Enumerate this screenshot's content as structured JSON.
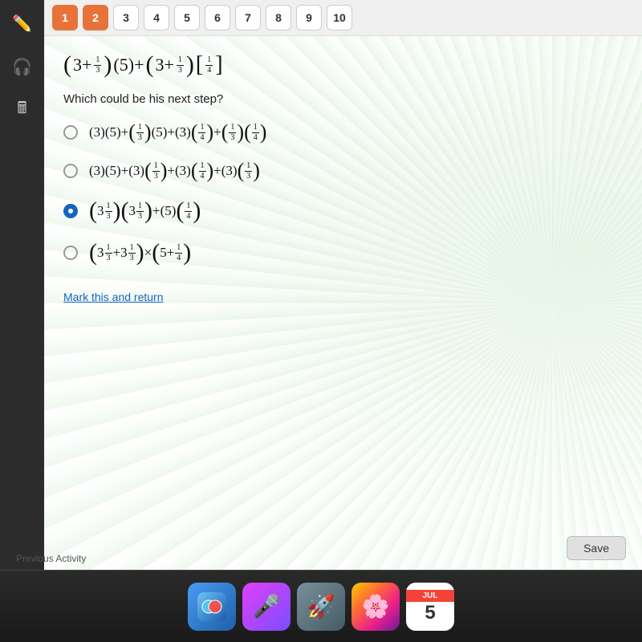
{
  "tabs": {
    "items": [
      {
        "label": "1",
        "state": "active"
      },
      {
        "label": "2",
        "state": "active"
      },
      {
        "label": "3",
        "state": "normal"
      },
      {
        "label": "4",
        "state": "normal"
      },
      {
        "label": "5",
        "state": "normal"
      },
      {
        "label": "6",
        "state": "normal"
      },
      {
        "label": "7",
        "state": "normal"
      },
      {
        "label": "8",
        "state": "normal"
      },
      {
        "label": "9",
        "state": "normal"
      },
      {
        "label": "10",
        "state": "normal"
      }
    ]
  },
  "question": {
    "text": "Which could be his next step?",
    "main_expression": "(3 + 1/3)(5) + (3 + 1/3)(1/4)"
  },
  "options": [
    {
      "id": "A",
      "selected": false,
      "expr": "(3)(5) + (1/3)(5) + (3)(1/4) + (1/3)(1/4)"
    },
    {
      "id": "B",
      "selected": false,
      "expr": "(3)(5) + (3)(1/3) + (3)(1/4) + (3)(1/3)"
    },
    {
      "id": "C",
      "selected": true,
      "expr": "(3 1/3)(3 1/3) + (5)(1/4)"
    },
    {
      "id": "D",
      "selected": false,
      "expr": "(3 1/3 + 3 1/3) x (5 + 1/4)"
    }
  ],
  "mark_return": "Mark this and return",
  "save_label": "Save",
  "prev_activity": "Previous Activity",
  "dock": {
    "month": "JUL",
    "day": "5"
  }
}
